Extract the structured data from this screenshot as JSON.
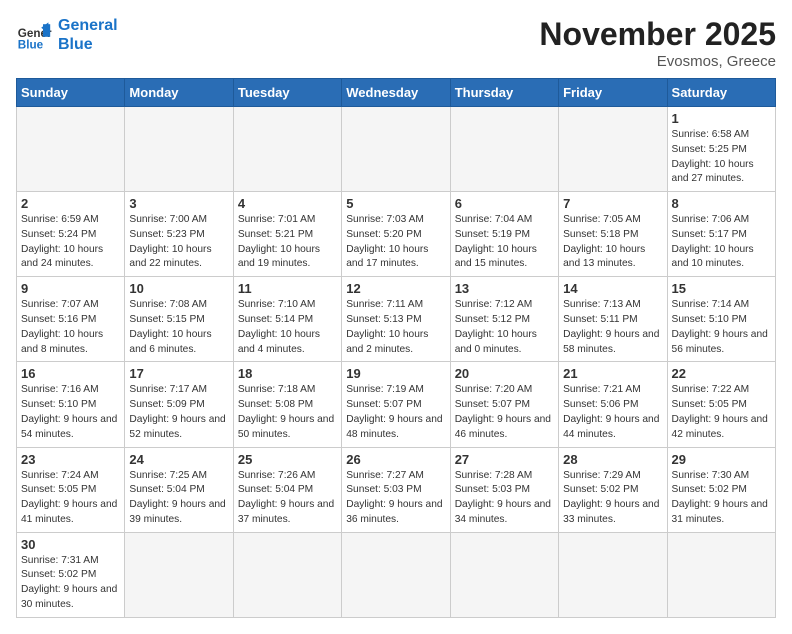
{
  "header": {
    "logo_general": "General",
    "logo_blue": "Blue",
    "month": "November 2025",
    "location": "Evosmos, Greece"
  },
  "weekdays": [
    "Sunday",
    "Monday",
    "Tuesday",
    "Wednesday",
    "Thursday",
    "Friday",
    "Saturday"
  ],
  "weeks": [
    [
      {
        "day": "",
        "info": ""
      },
      {
        "day": "",
        "info": ""
      },
      {
        "day": "",
        "info": ""
      },
      {
        "day": "",
        "info": ""
      },
      {
        "day": "",
        "info": ""
      },
      {
        "day": "",
        "info": ""
      },
      {
        "day": "1",
        "info": "Sunrise: 6:58 AM\nSunset: 5:25 PM\nDaylight: 10 hours and 27 minutes."
      }
    ],
    [
      {
        "day": "2",
        "info": "Sunrise: 6:59 AM\nSunset: 5:24 PM\nDaylight: 10 hours and 24 minutes."
      },
      {
        "day": "3",
        "info": "Sunrise: 7:00 AM\nSunset: 5:23 PM\nDaylight: 10 hours and 22 minutes."
      },
      {
        "day": "4",
        "info": "Sunrise: 7:01 AM\nSunset: 5:21 PM\nDaylight: 10 hours and 19 minutes."
      },
      {
        "day": "5",
        "info": "Sunrise: 7:03 AM\nSunset: 5:20 PM\nDaylight: 10 hours and 17 minutes."
      },
      {
        "day": "6",
        "info": "Sunrise: 7:04 AM\nSunset: 5:19 PM\nDaylight: 10 hours and 15 minutes."
      },
      {
        "day": "7",
        "info": "Sunrise: 7:05 AM\nSunset: 5:18 PM\nDaylight: 10 hours and 13 minutes."
      },
      {
        "day": "8",
        "info": "Sunrise: 7:06 AM\nSunset: 5:17 PM\nDaylight: 10 hours and 10 minutes."
      }
    ],
    [
      {
        "day": "9",
        "info": "Sunrise: 7:07 AM\nSunset: 5:16 PM\nDaylight: 10 hours and 8 minutes."
      },
      {
        "day": "10",
        "info": "Sunrise: 7:08 AM\nSunset: 5:15 PM\nDaylight: 10 hours and 6 minutes."
      },
      {
        "day": "11",
        "info": "Sunrise: 7:10 AM\nSunset: 5:14 PM\nDaylight: 10 hours and 4 minutes."
      },
      {
        "day": "12",
        "info": "Sunrise: 7:11 AM\nSunset: 5:13 PM\nDaylight: 10 hours and 2 minutes."
      },
      {
        "day": "13",
        "info": "Sunrise: 7:12 AM\nSunset: 5:12 PM\nDaylight: 10 hours and 0 minutes."
      },
      {
        "day": "14",
        "info": "Sunrise: 7:13 AM\nSunset: 5:11 PM\nDaylight: 9 hours and 58 minutes."
      },
      {
        "day": "15",
        "info": "Sunrise: 7:14 AM\nSunset: 5:10 PM\nDaylight: 9 hours and 56 minutes."
      }
    ],
    [
      {
        "day": "16",
        "info": "Sunrise: 7:16 AM\nSunset: 5:10 PM\nDaylight: 9 hours and 54 minutes."
      },
      {
        "day": "17",
        "info": "Sunrise: 7:17 AM\nSunset: 5:09 PM\nDaylight: 9 hours and 52 minutes."
      },
      {
        "day": "18",
        "info": "Sunrise: 7:18 AM\nSunset: 5:08 PM\nDaylight: 9 hours and 50 minutes."
      },
      {
        "day": "19",
        "info": "Sunrise: 7:19 AM\nSunset: 5:07 PM\nDaylight: 9 hours and 48 minutes."
      },
      {
        "day": "20",
        "info": "Sunrise: 7:20 AM\nSunset: 5:07 PM\nDaylight: 9 hours and 46 minutes."
      },
      {
        "day": "21",
        "info": "Sunrise: 7:21 AM\nSunset: 5:06 PM\nDaylight: 9 hours and 44 minutes."
      },
      {
        "day": "22",
        "info": "Sunrise: 7:22 AM\nSunset: 5:05 PM\nDaylight: 9 hours and 42 minutes."
      }
    ],
    [
      {
        "day": "23",
        "info": "Sunrise: 7:24 AM\nSunset: 5:05 PM\nDaylight: 9 hours and 41 minutes."
      },
      {
        "day": "24",
        "info": "Sunrise: 7:25 AM\nSunset: 5:04 PM\nDaylight: 9 hours and 39 minutes."
      },
      {
        "day": "25",
        "info": "Sunrise: 7:26 AM\nSunset: 5:04 PM\nDaylight: 9 hours and 37 minutes."
      },
      {
        "day": "26",
        "info": "Sunrise: 7:27 AM\nSunset: 5:03 PM\nDaylight: 9 hours and 36 minutes."
      },
      {
        "day": "27",
        "info": "Sunrise: 7:28 AM\nSunset: 5:03 PM\nDaylight: 9 hours and 34 minutes."
      },
      {
        "day": "28",
        "info": "Sunrise: 7:29 AM\nSunset: 5:02 PM\nDaylight: 9 hours and 33 minutes."
      },
      {
        "day": "29",
        "info": "Sunrise: 7:30 AM\nSunset: 5:02 PM\nDaylight: 9 hours and 31 minutes."
      }
    ],
    [
      {
        "day": "30",
        "info": "Sunrise: 7:31 AM\nSunset: 5:02 PM\nDaylight: 9 hours and 30 minutes."
      },
      {
        "day": "",
        "info": ""
      },
      {
        "day": "",
        "info": ""
      },
      {
        "day": "",
        "info": ""
      },
      {
        "day": "",
        "info": ""
      },
      {
        "day": "",
        "info": ""
      },
      {
        "day": "",
        "info": ""
      }
    ]
  ]
}
